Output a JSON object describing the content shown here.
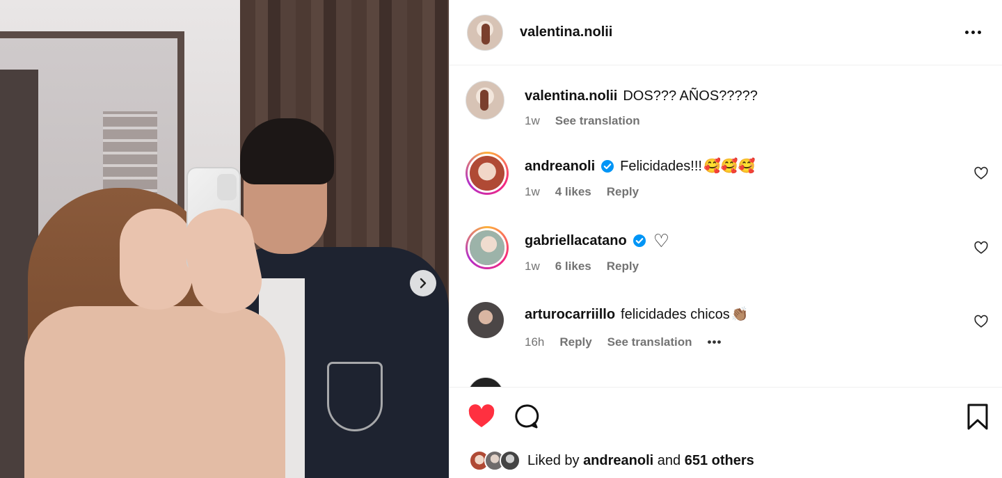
{
  "post": {
    "author": "valentina.nolii",
    "caption": "DOS??? AÑOS?????",
    "caption_time": "1w",
    "caption_translate": "See translation"
  },
  "comments": [
    {
      "user": "andreanoli",
      "verified": true,
      "text": "Felicidades!!!",
      "emoji": "🥰🥰🥰",
      "time": "1w",
      "likes": "4 likes",
      "reply": "Reply"
    },
    {
      "user": "gabriellacatano",
      "verified": true,
      "text": "",
      "emoji": "♡",
      "time": "1w",
      "likes": "6 likes",
      "reply": "Reply"
    },
    {
      "user": "arturocarriillo",
      "verified": false,
      "text": "felicidades chicos",
      "emoji": "👏🏽",
      "time": "16h",
      "reply": "Reply",
      "translate": "See translation",
      "more": "•••"
    }
  ],
  "footer": {
    "liked_prefix": "Liked by",
    "liked_user": "andreanoli",
    "liked_and": "and",
    "liked_others": "651 others"
  },
  "colors": {
    "heart": "#ff3040",
    "verified": "#0095f6",
    "muted": "#737373"
  },
  "icons": [
    "chevron-right-icon",
    "more-icon",
    "verified-icon",
    "heart-outline-icon",
    "heart-filled-icon",
    "comment-icon",
    "bookmark-icon"
  ]
}
